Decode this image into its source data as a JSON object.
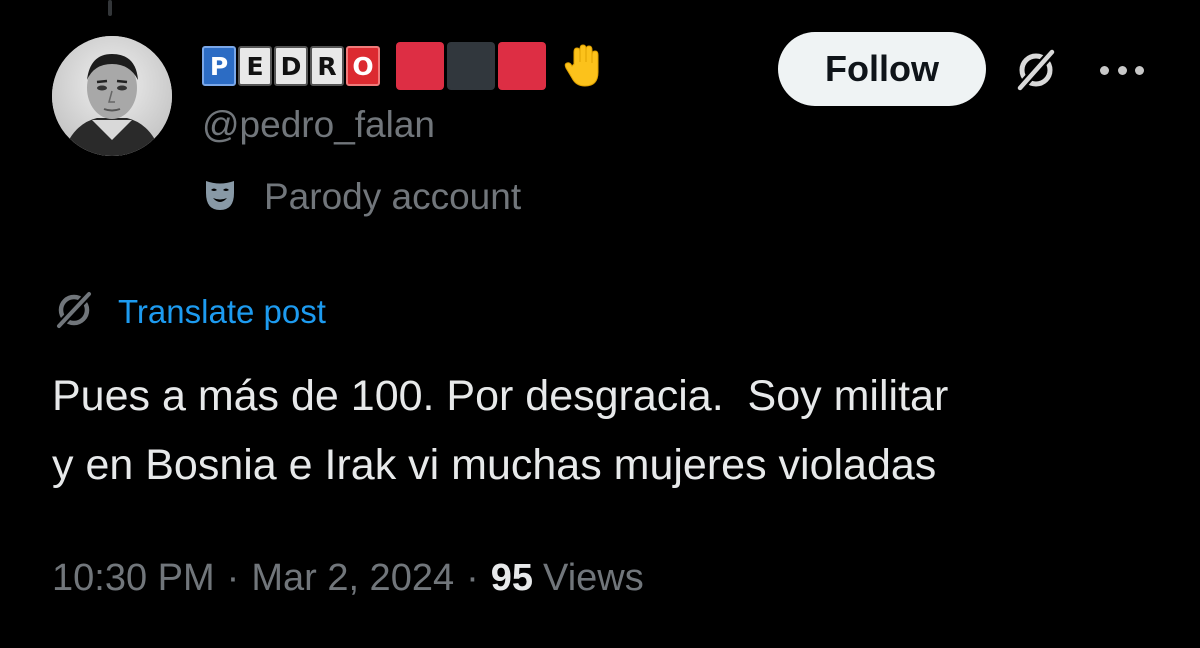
{
  "author": {
    "name_tiles": [
      "P",
      "E",
      "D",
      "R",
      "O"
    ],
    "handle": "@pedro_falan",
    "label_text": "Parody account",
    "label_icon": "theater-mask-icon",
    "hand_emoji": "raised-hand-icon",
    "square_colors": [
      "#dd2e44",
      "#31373d",
      "#dd2e44"
    ]
  },
  "actions": {
    "follow_label": "Follow",
    "grok_icon": "grok-icon",
    "more_icon": "more-options-icon"
  },
  "translate": {
    "label": "Translate post",
    "icon": "grok-translate-icon"
  },
  "post": {
    "line1": "Pues a más de 100. Por desgracia.  Soy militar",
    "line2": "y en Bosnia e Irak vi muchas mujeres violadas"
  },
  "meta": {
    "time": "10:30 PM",
    "date": "Mar 2, 2024",
    "separator": "·",
    "views_count": "95",
    "views_label": "Views"
  },
  "colors": {
    "background": "#000000",
    "primary_text": "#e7e9ea",
    "secondary_text": "#71767b",
    "link": "#1d9bf0",
    "follow_bg": "#eff3f4"
  }
}
